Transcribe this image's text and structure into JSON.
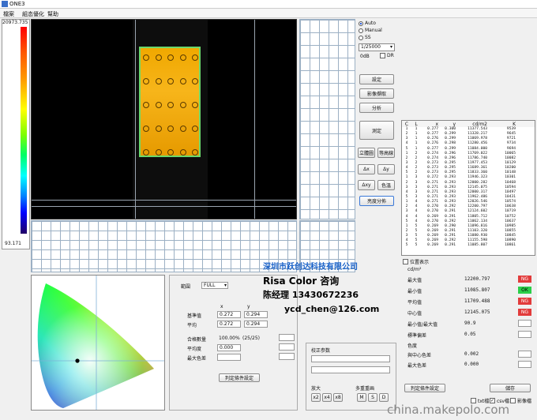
{
  "window": {
    "title": "ONE3",
    "icon": "app-icon"
  },
  "menu": [
    "檔案",
    "組态優化",
    "幫助"
  ],
  "scale": {
    "max": "20973.735",
    "min": "93.171"
  },
  "controls": {
    "modes": [
      {
        "label": "Auto",
        "selected": true
      },
      {
        "label": "Manual",
        "selected": false
      },
      {
        "label": "SS",
        "selected": false
      }
    ],
    "exposure": "1/25000",
    "gain_label": "0dB",
    "dr_label": "DR",
    "buttons": {
      "settings": "設定",
      "capture": "影像擷取",
      "analyze": "分析",
      "measure": "測定",
      "solid": "立體圖",
      "contour": "等高線",
      "dx": "Δx",
      "dy": "Δy",
      "dxy": "Δxy",
      "color": "色溫",
      "distribution": "亮度分佈"
    }
  },
  "table": {
    "headers": [
      "C",
      "L",
      "x",
      "y",
      "cd/m2",
      "K"
    ],
    "rows": [
      [
        "1",
        "1",
        "0.277",
        "0.300",
        "11377.543",
        "9539"
      ],
      [
        "2",
        "1",
        "0.277",
        "0.299",
        "11328.217",
        "9645"
      ],
      [
        "3",
        "1",
        "0.276",
        "0.299",
        "11069.978",
        "9721"
      ],
      [
        "4",
        "1",
        "0.276",
        "0.298",
        "11280.456",
        "9734"
      ],
      [
        "5",
        "1",
        "0.277",
        "0.299",
        "11084.000",
        "9694"
      ],
      [
        "1",
        "2",
        "0.274",
        "0.296",
        "11769.022",
        "10065"
      ],
      [
        "2",
        "2",
        "0.274",
        "0.296",
        "11786.740",
        "10082"
      ],
      [
        "3",
        "2",
        "0.273",
        "0.295",
        "11977.453",
        "10129"
      ],
      [
        "4",
        "2",
        "0.273",
        "0.295",
        "11689.361",
        "10200"
      ],
      [
        "5",
        "2",
        "0.273",
        "0.295",
        "11833.360",
        "10148"
      ],
      [
        "1",
        "3",
        "0.272",
        "0.293",
        "11946.323",
        "10301"
      ],
      [
        "2",
        "3",
        "0.271",
        "0.293",
        "12000.282",
        "10468"
      ],
      [
        "3",
        "3",
        "0.271",
        "0.293",
        "12145.075",
        "10594"
      ],
      [
        "4",
        "3",
        "0.271",
        "0.293",
        "12000.317",
        "10497"
      ],
      [
        "5",
        "3",
        "0.271",
        "0.293",
        "11962.486",
        "10431"
      ],
      [
        "1",
        "4",
        "0.271",
        "0.293",
        "12026.546",
        "10574"
      ],
      [
        "2",
        "4",
        "0.270",
        "0.292",
        "12200.797",
        "10638"
      ],
      [
        "3",
        "4",
        "0.270",
        "0.291",
        "12124.602",
        "10719"
      ],
      [
        "4",
        "4",
        "0.269",
        "0.291",
        "11805.712",
        "10752"
      ],
      [
        "5",
        "4",
        "0.270",
        "0.292",
        "11062.134",
        "10637"
      ],
      [
        "1",
        "5",
        "0.269",
        "0.290",
        "11096.816",
        "10985"
      ],
      [
        "2",
        "5",
        "0.269",
        "0.291",
        "11103.320",
        "10855"
      ],
      [
        "3",
        "5",
        "0.269",
        "0.291",
        "11080.930",
        "10845"
      ],
      [
        "4",
        "5",
        "0.269",
        "0.292",
        "11155.598",
        "10890"
      ],
      [
        "5",
        "5",
        "0.269",
        "0.291",
        "11085.807",
        "10861"
      ]
    ]
  },
  "stats": {
    "position_label": "位置表示",
    "unit": "cd/m²",
    "rows": [
      {
        "label": "最大值",
        "value": "12200.797",
        "status": "NG"
      },
      {
        "label": "最小值",
        "value": "11085.807",
        "status": "OK"
      },
      {
        "label": "平均值",
        "value": "11709.488",
        "status": "NG"
      },
      {
        "label": "中心值",
        "value": "12145.075",
        "status": "NG"
      },
      {
        "label": "最小值/最大值",
        "value": "90.9",
        "status": ""
      },
      {
        "label": "標準偏差",
        "value": "0.05",
        "status": ""
      }
    ],
    "color_section": "色度",
    "color_rows": [
      {
        "label": "與中心色差",
        "value": "0.002"
      },
      {
        "label": "最大色差",
        "value": "0.000"
      }
    ],
    "judge_button": "判定條件設定",
    "save_button": "儲存",
    "checks": [
      {
        "label": "txt檔",
        "checked": false
      },
      {
        "label": "csv檔",
        "checked": true
      },
      {
        "label": "影像檔",
        "checked": false
      }
    ]
  },
  "form": {
    "range_label": "範圍",
    "range_value": "FULL",
    "col_x": "x",
    "col_y": "y",
    "base_label": "基準值",
    "base_x": "0.272",
    "base_y": "0.294",
    "avg_label": "平均",
    "avg_x": "0.272",
    "avg_y": "0.294",
    "pass_label": "合格數量",
    "pass_value": "100.00%",
    "pass_count": "(25/25)",
    "uniform_label": "平均度",
    "uniform_value": "0.000",
    "maxdiff_label": "最大色差",
    "judge_button": "判定條件設定"
  },
  "correction": {
    "title": "校正参数",
    "zoom_label": "放大",
    "zoom_buttons": [
      "x2",
      "x4",
      "x8"
    ],
    "redisplay_label": "多重重画",
    "redisplay_buttons": [
      "M",
      "S",
      "D"
    ]
  },
  "overlay": {
    "company": "深圳市跃创达科技有限公司",
    "brand": "Risa Color 咨询",
    "contact": "陈经理  13430672236",
    "email": "ycd_chen@126.com"
  },
  "watermark": "china.makepolo.com",
  "colors": {
    "ng": "#e23b3b",
    "ok": "#2bcf4a",
    "accent": "#1a62c8"
  }
}
